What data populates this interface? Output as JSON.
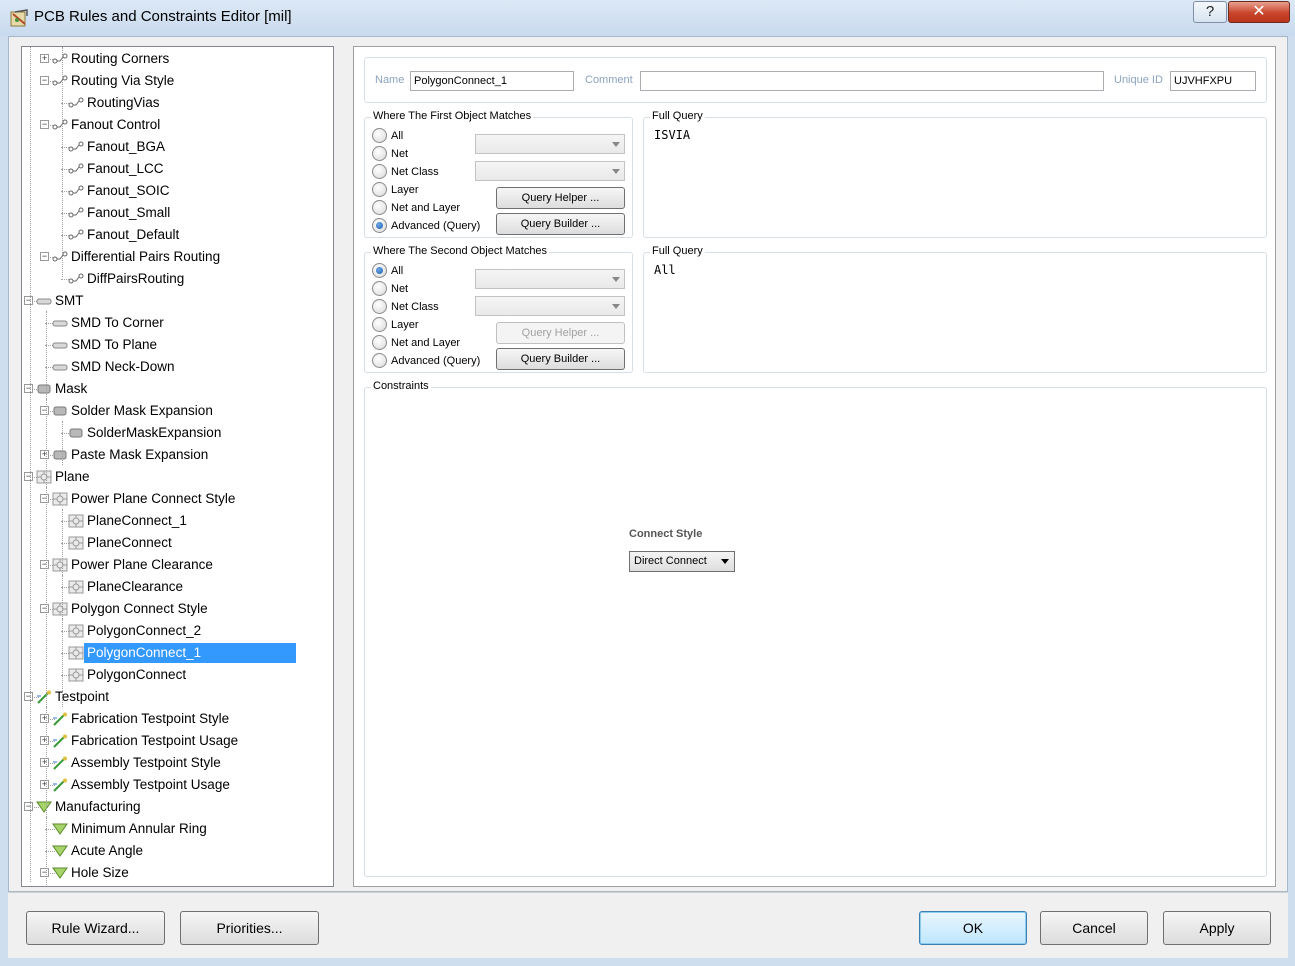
{
  "window": {
    "title": "PCB Rules and Constraints Editor [mil]",
    "help_glyph": "?",
    "close_glyph": "✕"
  },
  "tree": {
    "items": [
      {
        "label": "Routing Corners",
        "level": 2,
        "expander": "+",
        "icon": "routing-icon"
      },
      {
        "label": "Routing Via Style",
        "level": 2,
        "expander": "-",
        "icon": "routing-icon"
      },
      {
        "label": "RoutingVias",
        "level": 3,
        "expander": "",
        "icon": "routing-icon"
      },
      {
        "label": "Fanout Control",
        "level": 2,
        "expander": "-",
        "icon": "routing-icon"
      },
      {
        "label": "Fanout_BGA",
        "level": 3,
        "expander": "",
        "icon": "routing-icon"
      },
      {
        "label": "Fanout_LCC",
        "level": 3,
        "expander": "",
        "icon": "routing-icon"
      },
      {
        "label": "Fanout_SOIC",
        "level": 3,
        "expander": "",
        "icon": "routing-icon"
      },
      {
        "label": "Fanout_Small",
        "level": 3,
        "expander": "",
        "icon": "routing-icon"
      },
      {
        "label": "Fanout_Default",
        "level": 3,
        "expander": "",
        "icon": "routing-icon"
      },
      {
        "label": "Differential Pairs Routing",
        "level": 2,
        "expander": "-",
        "icon": "routing-icon"
      },
      {
        "label": "DiffPairsRouting",
        "level": 3,
        "expander": "",
        "icon": "routing-icon"
      },
      {
        "label": "SMT",
        "level": 1,
        "expander": "-",
        "icon": "smt-icon"
      },
      {
        "label": "SMD To Corner",
        "level": 2,
        "expander": "",
        "icon": "smt-icon"
      },
      {
        "label": "SMD To Plane",
        "level": 2,
        "expander": "",
        "icon": "smt-icon"
      },
      {
        "label": "SMD Neck-Down",
        "level": 2,
        "expander": "",
        "icon": "smt-icon"
      },
      {
        "label": "Mask",
        "level": 1,
        "expander": "-",
        "icon": "mask-icon"
      },
      {
        "label": "Solder Mask Expansion",
        "level": 2,
        "expander": "-",
        "icon": "mask-icon"
      },
      {
        "label": "SolderMaskExpansion",
        "level": 3,
        "expander": "",
        "icon": "mask-icon"
      },
      {
        "label": "Paste Mask Expansion",
        "level": 2,
        "expander": "+",
        "icon": "mask-icon"
      },
      {
        "label": "Plane",
        "level": 1,
        "expander": "-",
        "icon": "plane-icon"
      },
      {
        "label": "Power Plane Connect Style",
        "level": 2,
        "expander": "-",
        "icon": "plane-icon"
      },
      {
        "label": "PlaneConnect_1",
        "level": 3,
        "expander": "",
        "icon": "plane-icon"
      },
      {
        "label": "PlaneConnect",
        "level": 3,
        "expander": "",
        "icon": "plane-icon"
      },
      {
        "label": "Power Plane Clearance",
        "level": 2,
        "expander": "-",
        "icon": "plane-icon"
      },
      {
        "label": "PlaneClearance",
        "level": 3,
        "expander": "",
        "icon": "plane-icon"
      },
      {
        "label": "Polygon Connect Style",
        "level": 2,
        "expander": "-",
        "icon": "plane-icon"
      },
      {
        "label": "PolygonConnect_2",
        "level": 3,
        "expander": "",
        "icon": "plane-icon"
      },
      {
        "label": "PolygonConnect_1",
        "level": 3,
        "expander": "",
        "icon": "plane-icon",
        "selected": true
      },
      {
        "label": "PolygonConnect",
        "level": 3,
        "expander": "",
        "icon": "plane-icon"
      },
      {
        "label": "Testpoint",
        "level": 1,
        "expander": "-",
        "icon": "testpoint-icon"
      },
      {
        "label": "Fabrication Testpoint Style",
        "level": 2,
        "expander": "+",
        "icon": "testpoint-icon"
      },
      {
        "label": "Fabrication Testpoint Usage",
        "level": 2,
        "expander": "+",
        "icon": "testpoint-icon"
      },
      {
        "label": "Assembly Testpoint Style",
        "level": 2,
        "expander": "+",
        "icon": "testpoint-icon"
      },
      {
        "label": "Assembly Testpoint Usage",
        "level": 2,
        "expander": "+",
        "icon": "testpoint-icon"
      },
      {
        "label": "Manufacturing",
        "level": 1,
        "expander": "-",
        "icon": "manufacturing-icon"
      },
      {
        "label": "Minimum Annular Ring",
        "level": 2,
        "expander": "",
        "icon": "manufacturing-icon"
      },
      {
        "label": "Acute Angle",
        "level": 2,
        "expander": "",
        "icon": "manufacturing-icon"
      },
      {
        "label": "Hole Size",
        "level": 2,
        "expander": "-",
        "icon": "manufacturing-icon"
      }
    ]
  },
  "rule": {
    "name_label": "Name",
    "name_value": "PolygonConnect_1",
    "comment_label": "Comment",
    "comment_value": "",
    "unique_id_label": "Unique ID",
    "unique_id_value": "UJVHFXPU"
  },
  "first_match": {
    "title": "Where The First Object Matches",
    "options": [
      "All",
      "Net",
      "Net Class",
      "Layer",
      "Net and Layer",
      "Advanced (Query)"
    ],
    "selected": "Advanced (Query)",
    "query_helper_label": "Query Helper ...",
    "query_builder_label": "Query Builder ...",
    "full_query_title": "Full Query",
    "full_query": "ISVIA"
  },
  "second_match": {
    "title": "Where The Second Object Matches",
    "options": [
      "All",
      "Net",
      "Net Class",
      "Layer",
      "Net and Layer",
      "Advanced (Query)"
    ],
    "selected": "All",
    "query_helper_label": "Query Helper ...",
    "query_builder_label": "Query Builder ...",
    "full_query_title": "Full Query",
    "full_query": "All"
  },
  "constraints": {
    "title": "Constraints",
    "connect_style_label": "Connect Style",
    "connect_style_value": "Direct Connect"
  },
  "footer": {
    "rule_wizard_label": "Rule Wizard...",
    "priorities_label": "Priorities...",
    "ok_label": "OK",
    "cancel_label": "Cancel",
    "apply_label": "Apply"
  }
}
